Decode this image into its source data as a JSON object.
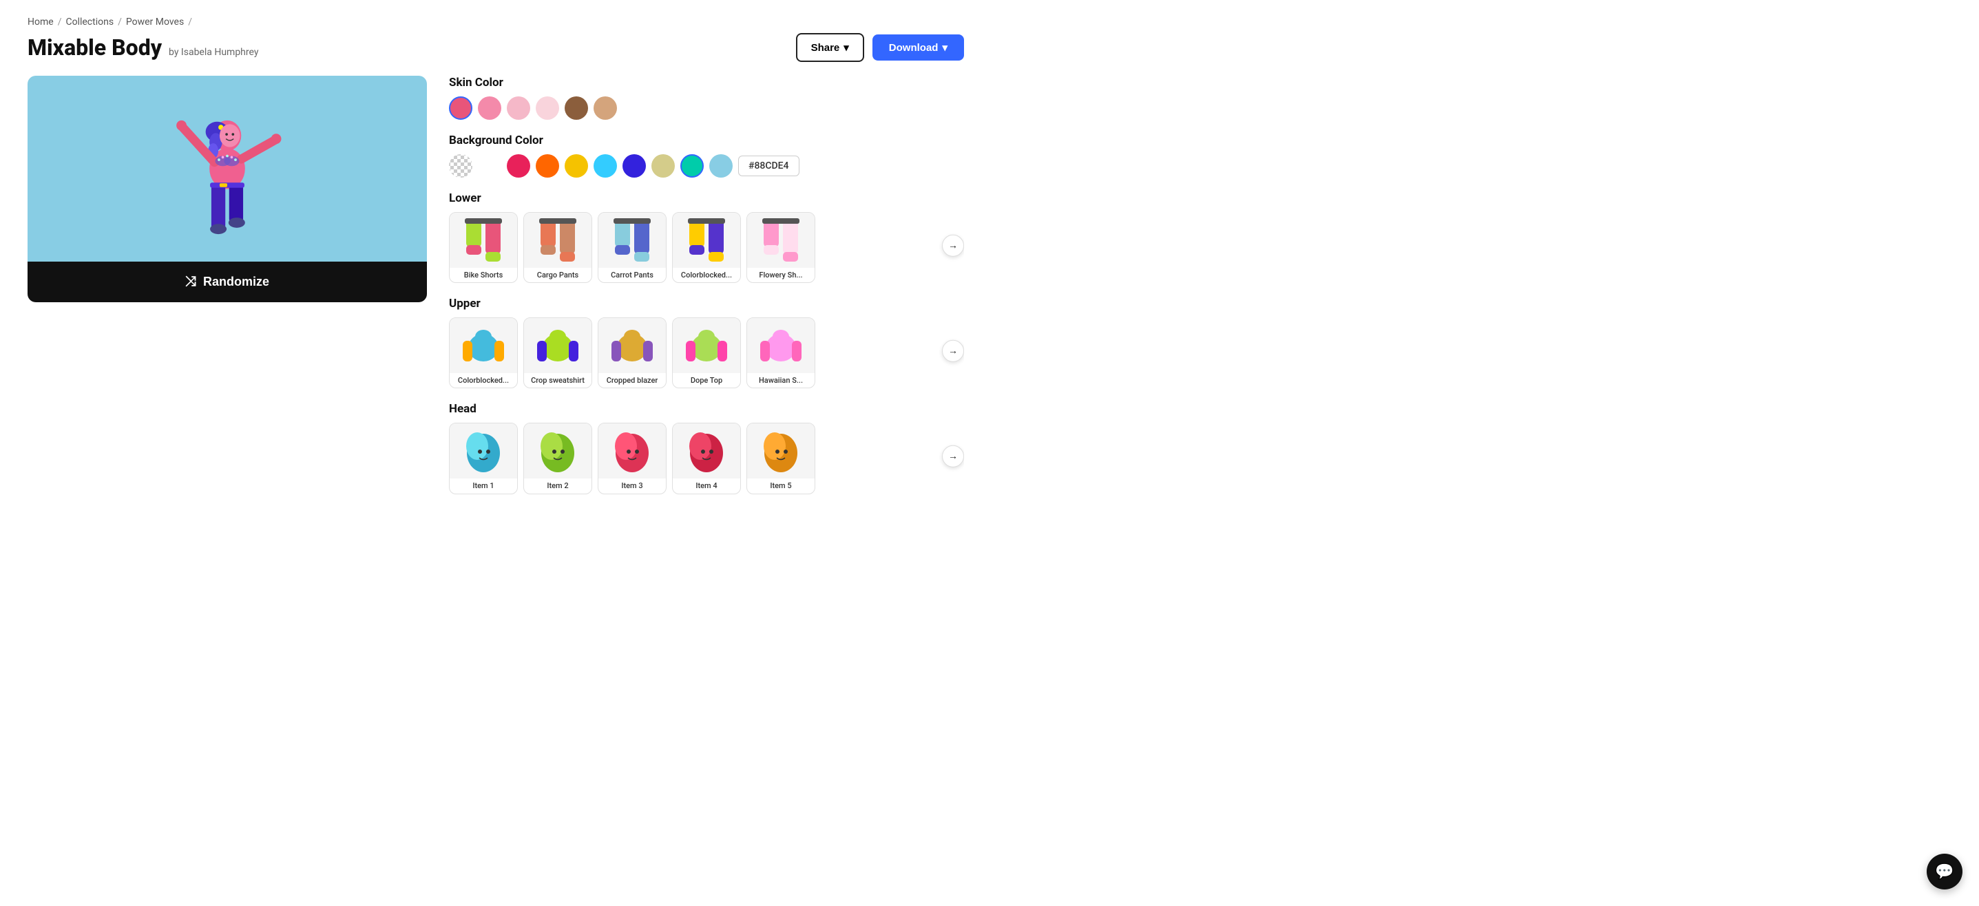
{
  "breadcrumb": {
    "items": [
      "Home",
      "Collections",
      "Power Moves"
    ]
  },
  "page": {
    "title": "Mixable Body",
    "author": "by Isabela Humphrey"
  },
  "header": {
    "share_label": "Share",
    "download_label": "Download"
  },
  "skin_color": {
    "label": "Skin Color",
    "swatches": [
      {
        "color": "#E8557A",
        "selected": true
      },
      {
        "color": "#F48AAA",
        "selected": false
      },
      {
        "color": "#F5B8C8",
        "selected": false
      },
      {
        "color": "#F9D4DC",
        "selected": false
      },
      {
        "color": "#8B5E3C",
        "selected": false
      },
      {
        "color": "#D4A47C",
        "selected": false
      }
    ]
  },
  "background_color": {
    "label": "Background Color",
    "swatches": [
      {
        "color": "transparent",
        "selected": false
      },
      {
        "color": "#FFFFFF",
        "selected": false
      },
      {
        "color": "#E8215A",
        "selected": false
      },
      {
        "color": "#FF6600",
        "selected": false
      },
      {
        "color": "#F5C200",
        "selected": false
      },
      {
        "color": "#33CCFF",
        "selected": false
      },
      {
        "color": "#3322DD",
        "selected": false
      },
      {
        "color": "#D4CC8A",
        "selected": false
      },
      {
        "color": "#00CCAA",
        "selected": true
      },
      {
        "color": "#88CDE4",
        "selected": false
      }
    ],
    "hex_value": "#88CDE4"
  },
  "lower": {
    "label": "Lower",
    "items": [
      {
        "label": "Bike Shorts",
        "color1": "#AADD33",
        "color2": "#E8557A"
      },
      {
        "label": "Cargo Pants",
        "color1": "#E87755",
        "color2": "#CC8866"
      },
      {
        "label": "Carrot Pants",
        "color1": "#88CCDD",
        "color2": "#5566CC"
      },
      {
        "label": "Colorblocked...",
        "color1": "#FFCC00",
        "color2": "#5533CC"
      },
      {
        "label": "Flowery Sh...",
        "color1": "#FF99CC",
        "color2": "#FFDDEE"
      }
    ]
  },
  "upper": {
    "label": "Upper",
    "items": [
      {
        "label": "Colorblocked...",
        "color1": "#44BBDD",
        "color2": "#FFAA00"
      },
      {
        "label": "Crop sweatshirt",
        "color1": "#AADD22",
        "color2": "#4422DD"
      },
      {
        "label": "Cropped blazer",
        "color1": "#DDAA33",
        "color2": "#8855BB"
      },
      {
        "label": "Dope Top",
        "color1": "#AADD55",
        "color2": "#FF44AA"
      },
      {
        "label": "Hawaiian S...",
        "color1": "#FF99EE",
        "color2": "#FF66BB"
      }
    ]
  },
  "head": {
    "label": "Head",
    "items": [
      {
        "label": "Item 1",
        "color1": "#66DDEE",
        "color2": "#33AACC"
      },
      {
        "label": "Item 2",
        "color1": "#AADD44",
        "color2": "#77BB22"
      },
      {
        "label": "Item 3",
        "color1": "#FF5577",
        "color2": "#DD3355"
      },
      {
        "label": "Item 4",
        "color1": "#EE4466",
        "color2": "#CC2244"
      },
      {
        "label": "Item 5",
        "color1": "#FFAA33",
        "color2": "#DD8811"
      }
    ]
  },
  "randomize_label": "Randomize",
  "icons": {
    "shuffle": "⤨",
    "chevron_down": "▾",
    "arrow_right": "→",
    "chat": "💬"
  }
}
